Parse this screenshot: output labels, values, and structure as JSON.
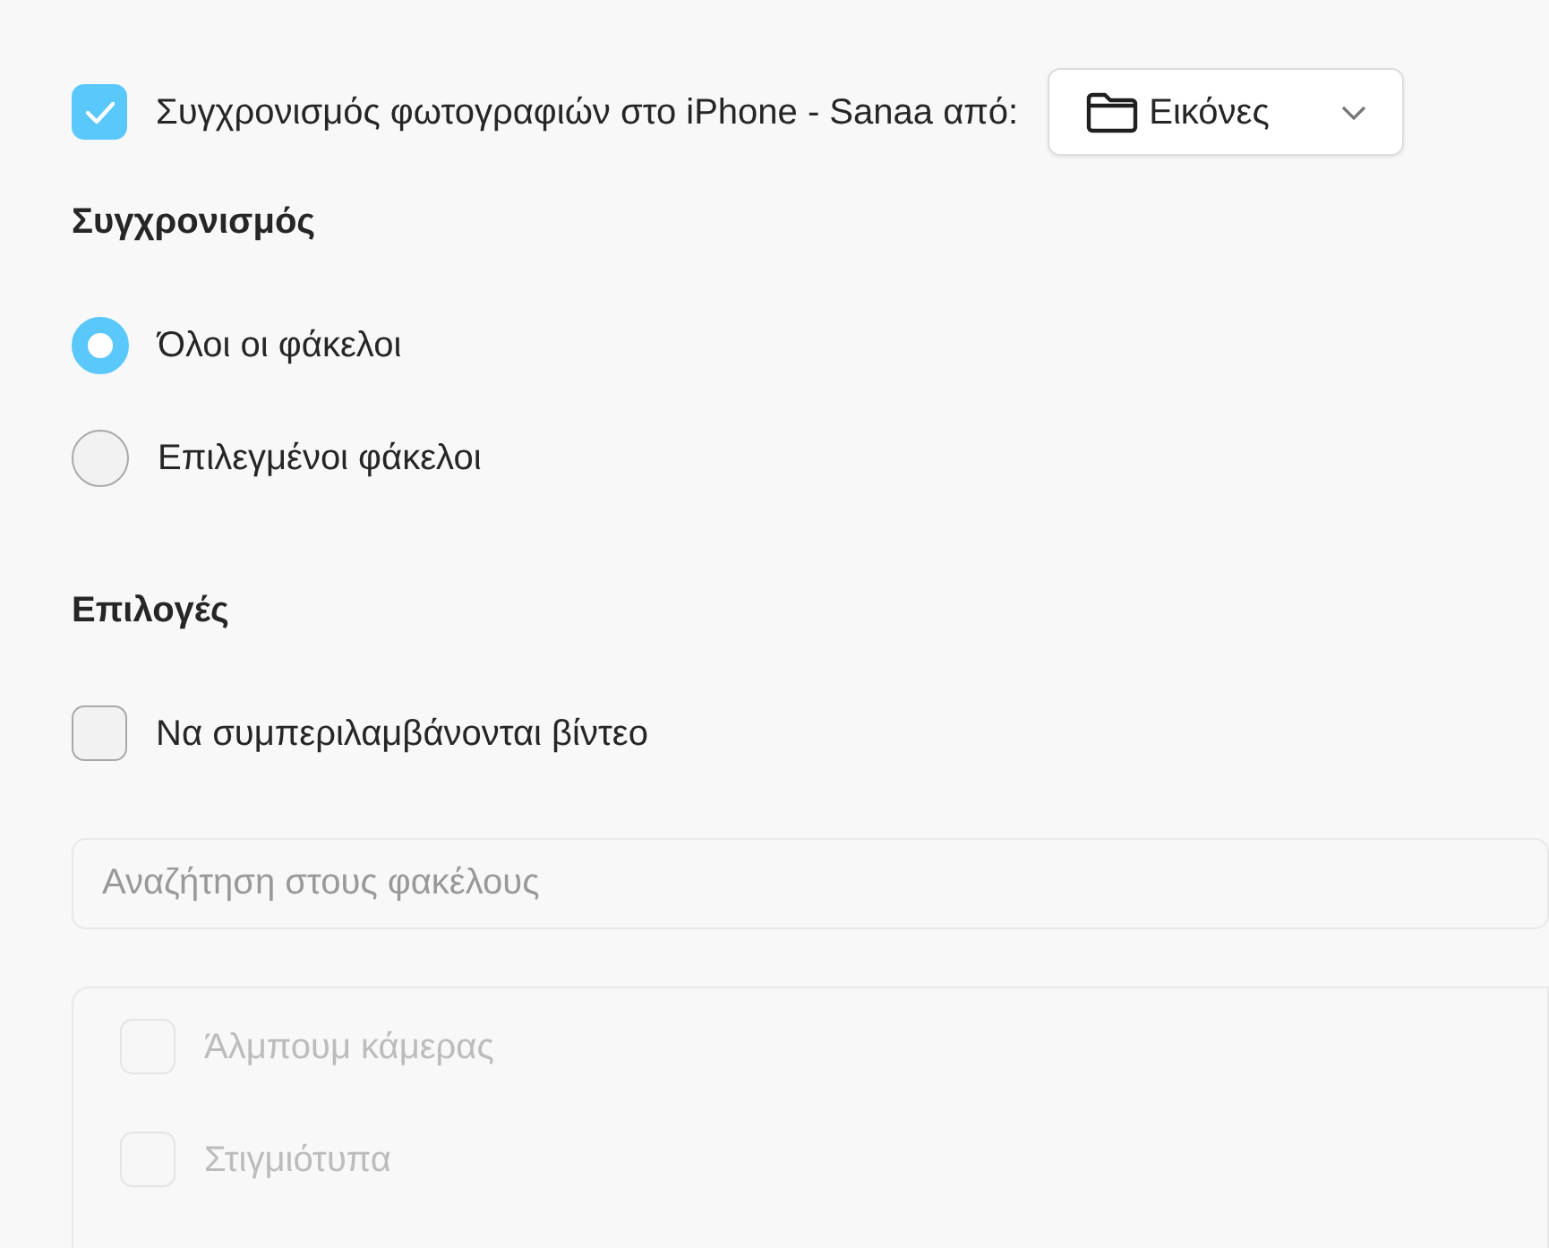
{
  "sync": {
    "checked": true,
    "label": "Συγχρονισμός φωτογραφιών στο iPhone - Sanaa από:",
    "source": "Εικόνες"
  },
  "sync_section": {
    "title": "Συγχρονισμός",
    "options": [
      {
        "label": "Όλοι οι φάκελοι",
        "selected": true
      },
      {
        "label": "Επιλεγμένοι φάκελοι",
        "selected": false
      }
    ]
  },
  "options_section": {
    "title": "Επιλογές",
    "items": [
      {
        "label": "Να συμπεριλαμβάνονται βίντεο",
        "checked": false
      }
    ]
  },
  "search": {
    "placeholder": "Αναζήτηση στους φακέλους"
  },
  "folders": {
    "disabled": true,
    "items": [
      {
        "label": "Άλμπουμ κάμερας",
        "checked": false
      },
      {
        "label": "Στιγμιότυπα",
        "checked": false
      }
    ]
  }
}
